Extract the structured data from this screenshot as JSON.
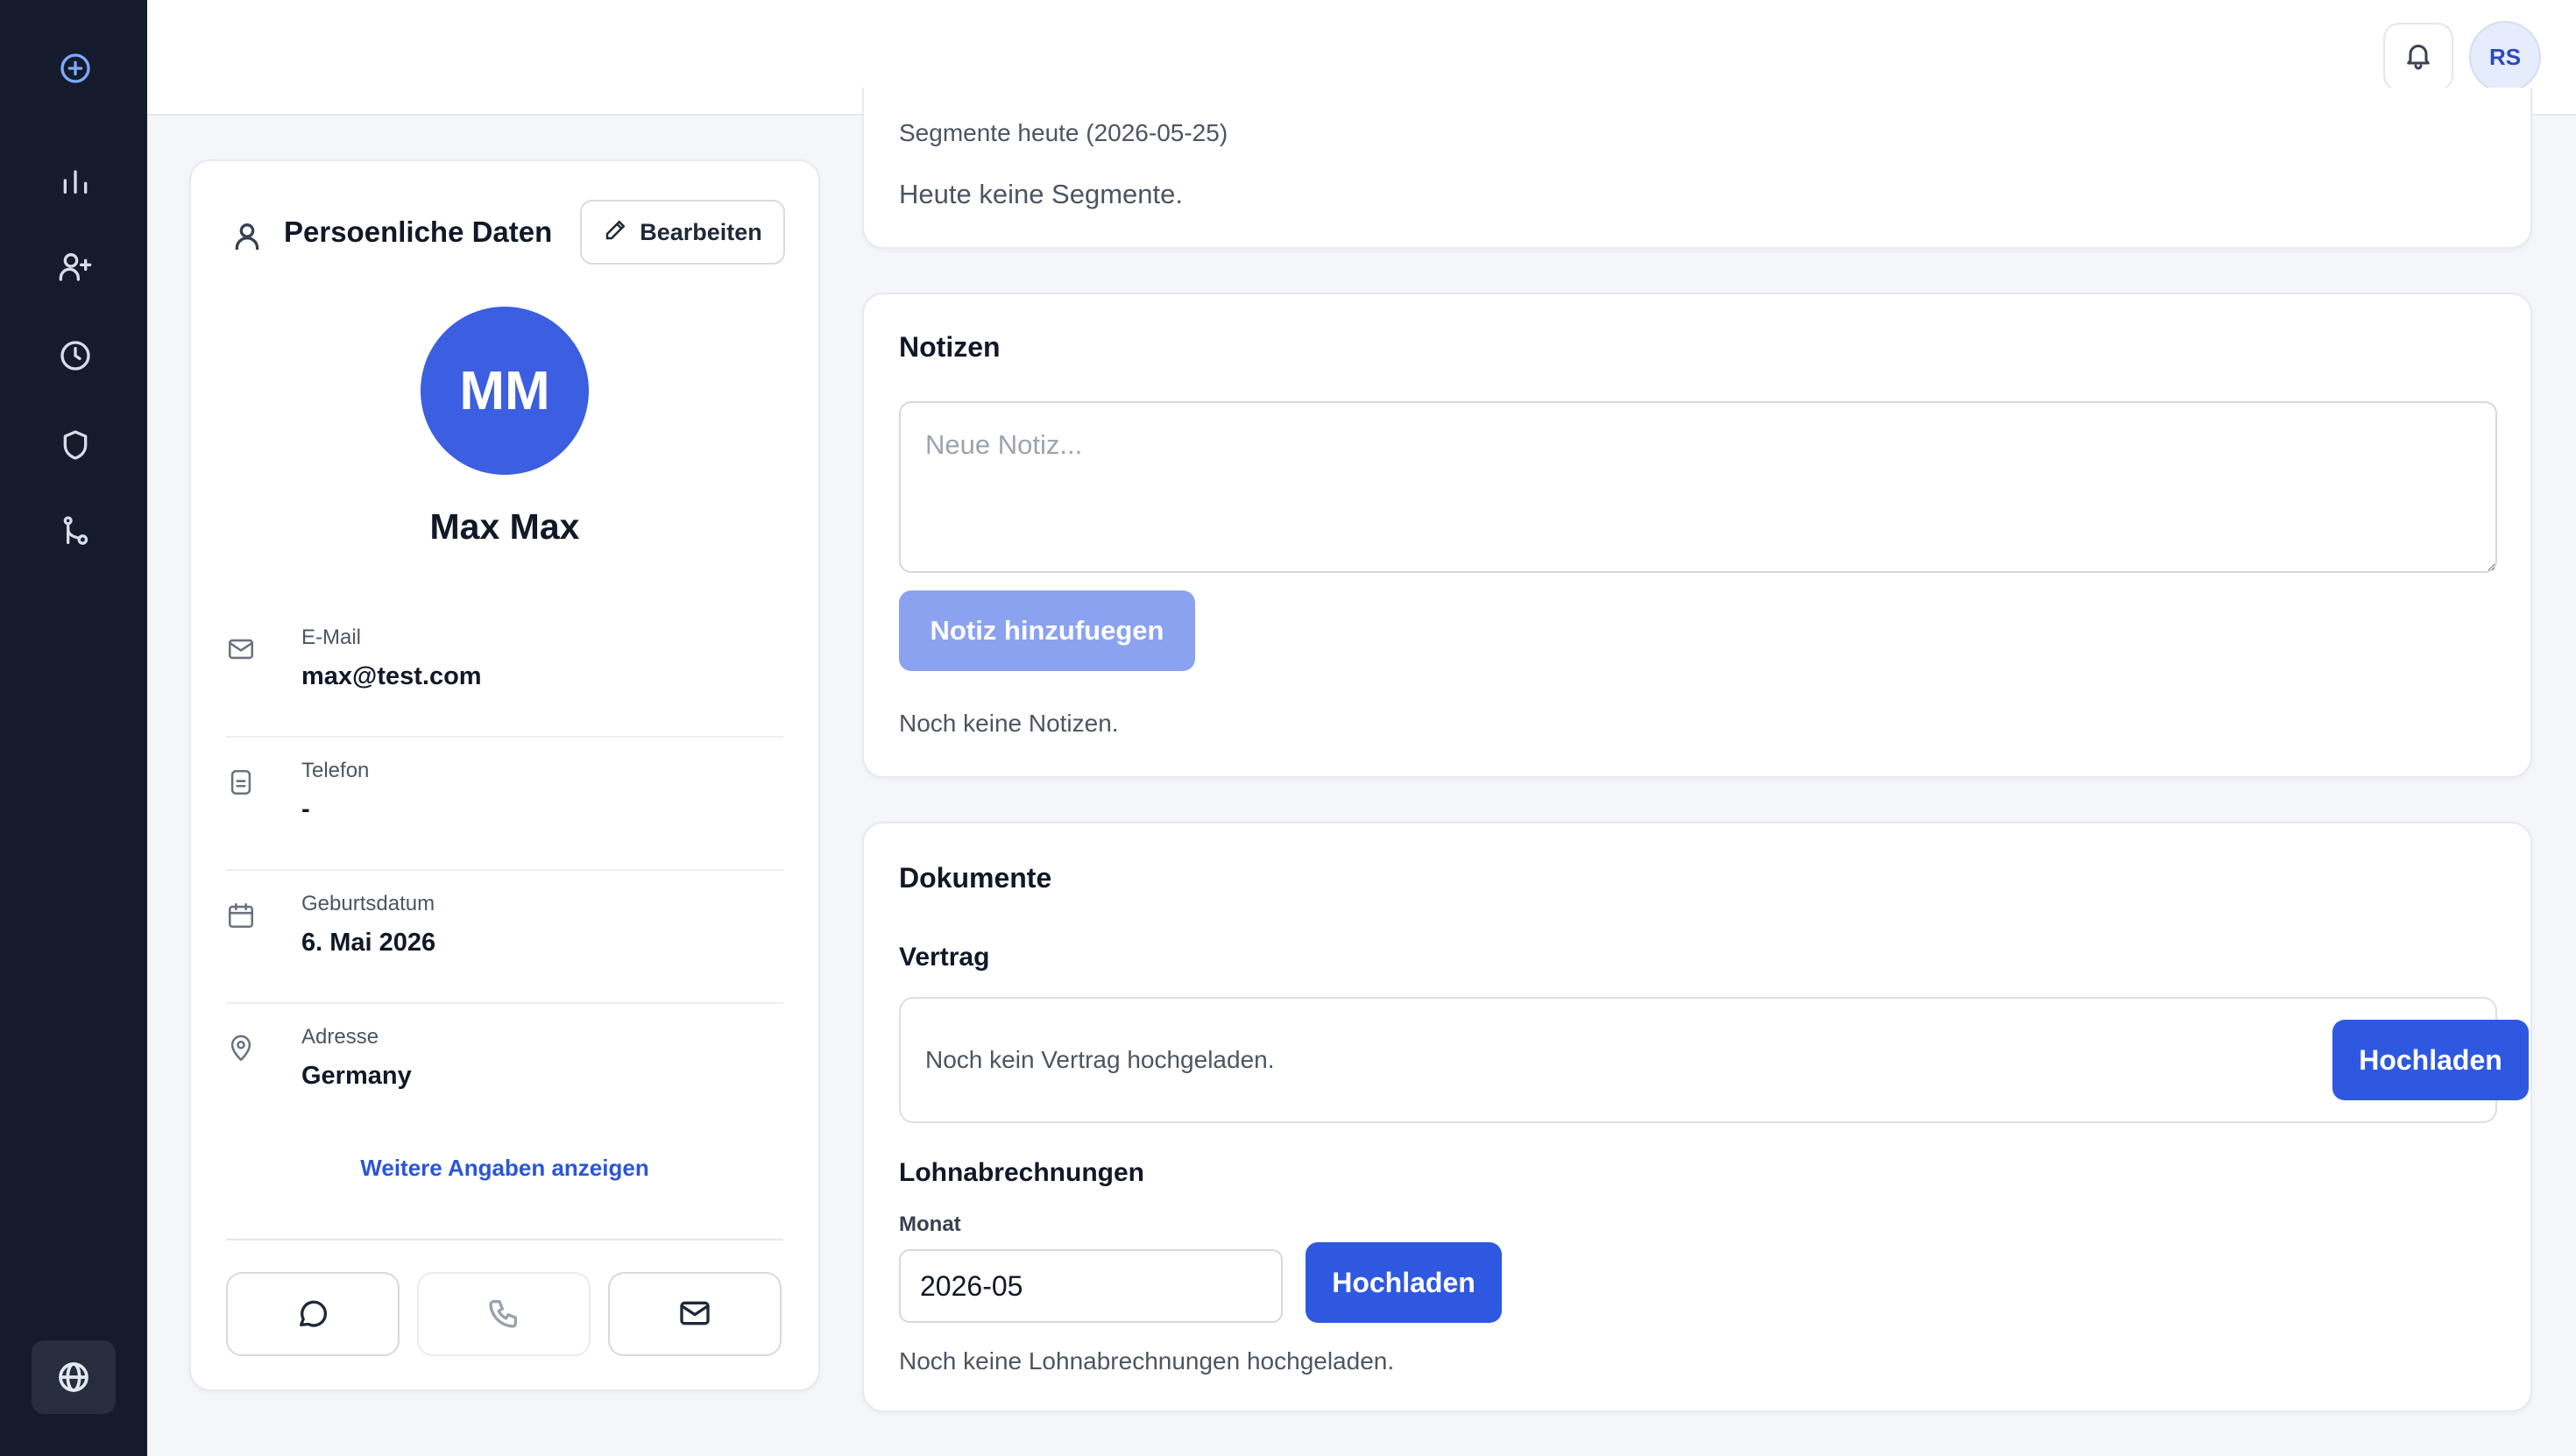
{
  "sidebar": {
    "top_icon": "plus-circle-icon",
    "items": [
      {
        "icon": "bar-chart-icon"
      },
      {
        "icon": "user-plus-icon"
      },
      {
        "icon": "clock-icon"
      },
      {
        "icon": "shield-icon"
      },
      {
        "icon": "branch-icon"
      }
    ],
    "bottom_icon": "globe-icon"
  },
  "topbar": {
    "bell_icon": "bell-icon",
    "user_initials": "RS"
  },
  "profile": {
    "title": "Persoenliche Daten",
    "edit_label": "Bearbeiten",
    "initials": "MM",
    "name": "Max Max",
    "fields": [
      {
        "label": "E-Mail",
        "value": "max@test.com",
        "icon": "mail-icon"
      },
      {
        "label": "Telefon",
        "value": "-",
        "icon": "phone-card-icon"
      },
      {
        "label": "Geburtsdatum",
        "value": "6. Mai 2026",
        "icon": "calendar-icon"
      },
      {
        "label": "Adresse",
        "value": "Germany",
        "icon": "map-pin-icon"
      }
    ],
    "more_link": "Weitere Angaben anzeigen",
    "actions": [
      "chat-icon",
      "phone-icon",
      "mail-icon"
    ]
  },
  "segments": {
    "title": "Segmente heute (2026-05-25)",
    "empty_text": "Heute keine Segmente."
  },
  "notes": {
    "title": "Notizen",
    "placeholder": "Neue Notiz...",
    "add_button": "Notiz hinzufuegen",
    "empty_text": "Noch keine Notizen."
  },
  "documents": {
    "title": "Dokumente",
    "contract": {
      "title": "Vertrag",
      "empty_text": "Noch kein Vertrag hochgeladen.",
      "upload_button": "Hochladen"
    },
    "payslips": {
      "title": "Lohnabrechnungen",
      "month_label": "Monat",
      "month_value": "2026-05",
      "upload_button": "Hochladen",
      "empty_text": "Noch keine Lohnabrechnungen hochgeladen."
    }
  },
  "colors": {
    "sidebar_bg": "#141b2d",
    "accent": "#2f58e0",
    "accent_disabled": "#8aa2ef",
    "link": "#2a56d6"
  }
}
